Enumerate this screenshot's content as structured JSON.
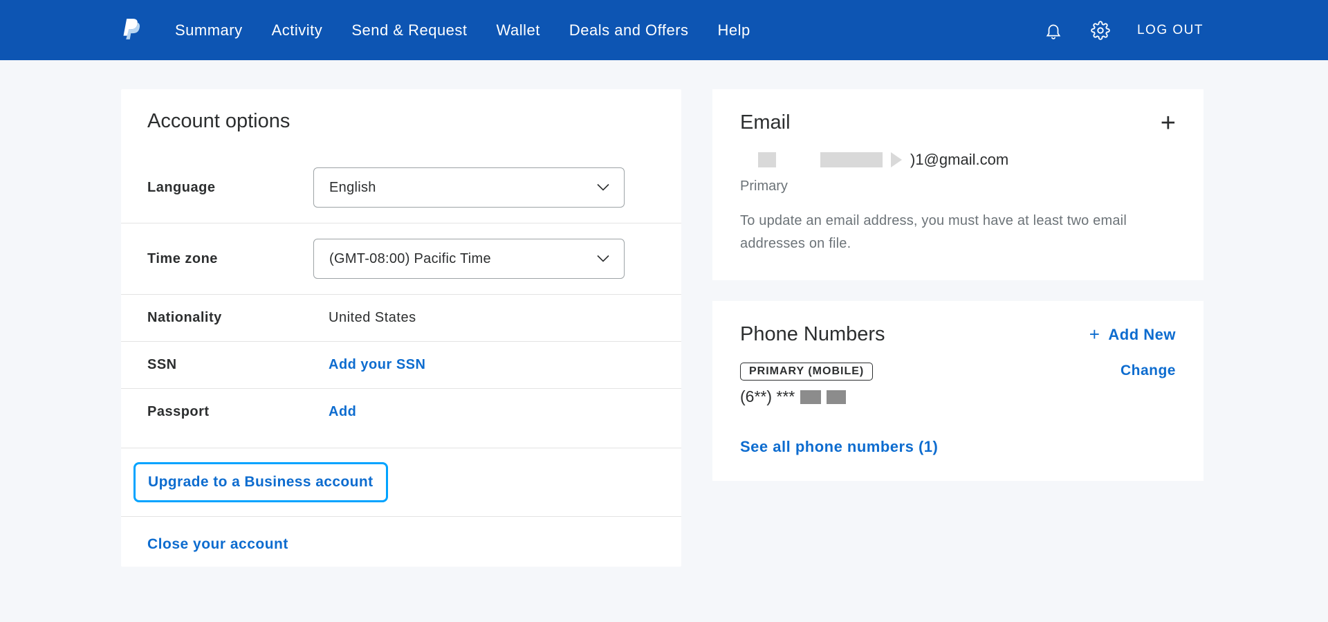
{
  "header": {
    "nav": [
      "Summary",
      "Activity",
      "Send & Request",
      "Wallet",
      "Deals and Offers",
      "Help"
    ],
    "logout": "LOG OUT"
  },
  "account": {
    "title": "Account options",
    "language_label": "Language",
    "language_value": "English",
    "timezone_label": "Time zone",
    "timezone_value": "(GMT-08:00) Pacific Time",
    "nationality_label": "Nationality",
    "nationality_value": "United States",
    "ssn_label": "SSN",
    "ssn_action": "Add your SSN",
    "passport_label": "Passport",
    "passport_action": "Add",
    "upgrade": "Upgrade to a Business account",
    "close": "Close your account"
  },
  "email": {
    "title": "Email",
    "address_suffix": ")1@gmail.com",
    "primary": "Primary",
    "help": "To update an email address, you must have at least two email addresses on file."
  },
  "phone": {
    "title": "Phone Numbers",
    "add_new": "Add New",
    "badge": "PRIMARY (MOBILE)",
    "masked": "(6**) ***",
    "change": "Change",
    "see_all": "See all phone numbers (1)"
  }
}
